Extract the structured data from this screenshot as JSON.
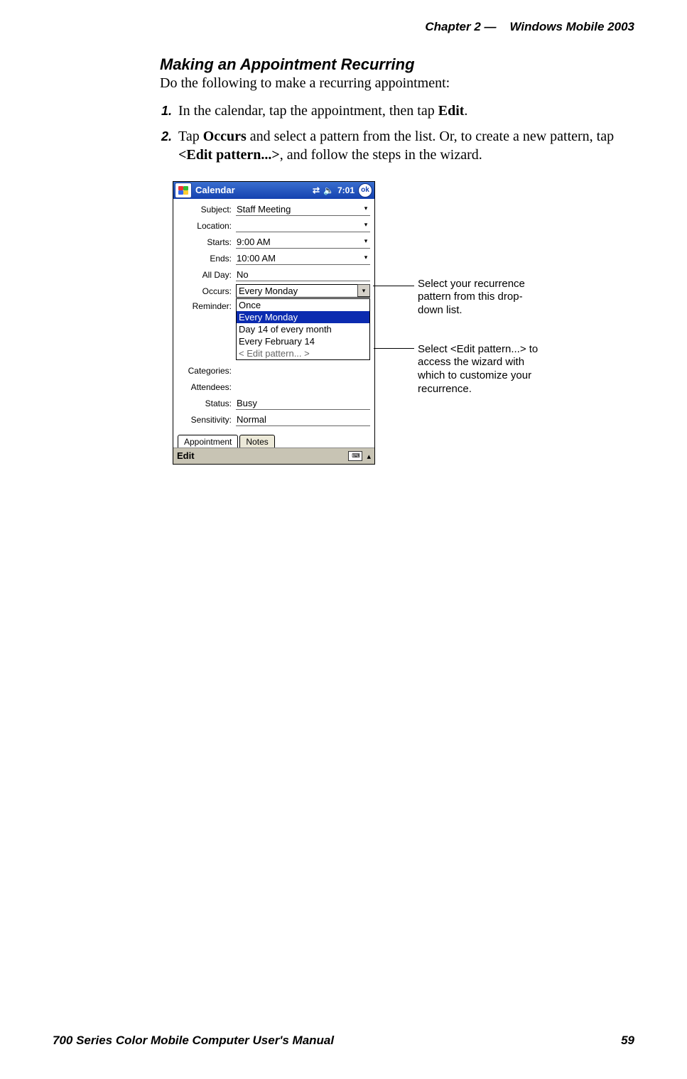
{
  "header": {
    "chapter": "Chapter  2",
    "dash": "—",
    "product": "Windows Mobile 2003"
  },
  "heading": "Making an Appointment Recurring",
  "lead": "Do the following to make a recurring appointment:",
  "steps": {
    "s1_a": "In the calendar, tap the appointment, then tap ",
    "s1_b": "Edit",
    "s1_c": ".",
    "s2_a": "Tap ",
    "s2_b": "Occurs",
    "s2_c": " and select a pattern from the list. Or, to create a new pat­tern, tap ",
    "s2_d": "<Edit pattern...>",
    "s2_e": ", and follow the steps in the wizard."
  },
  "device": {
    "app": "Calendar",
    "time": "7:01",
    "ok": "ok",
    "fields": {
      "subject_label": "Subject:",
      "subject_value": "Staff Meeting",
      "location_label": "Location:",
      "location_value": "",
      "starts_label": "Starts:",
      "starts_value": "9:00 AM",
      "ends_label": "Ends:",
      "ends_value": "10:00 AM",
      "allday_label": "All Day:",
      "allday_value": "No",
      "occurs_label": "Occurs:",
      "occurs_value": "Every Monday",
      "reminder_label": "Reminder:",
      "categories_label": "Categories:",
      "attendees_label": "Attendees:",
      "status_label": "Status:",
      "status_value": "Busy",
      "sensitivity_label": "Sensitivity:",
      "sensitivity_value": "Normal"
    },
    "dropdown": {
      "opt1": "Once",
      "opt2": "Every Monday",
      "opt3": "Day 14 of every month",
      "opt4": "Every February 14",
      "opt5": "< Edit pattern... >"
    },
    "tabs": {
      "appointment": "Appointment",
      "notes": "Notes"
    },
    "bottombar": {
      "edit": "Edit"
    }
  },
  "annotations": {
    "a1": "Select your recurrence pattern from this drop-down list.",
    "a2": "Select <Edit pattern...> to access the wizard with which to custom­ize your recurrence."
  },
  "footer": {
    "left": "700 Series Color Mobile Computer User's Manual",
    "right": "59"
  }
}
